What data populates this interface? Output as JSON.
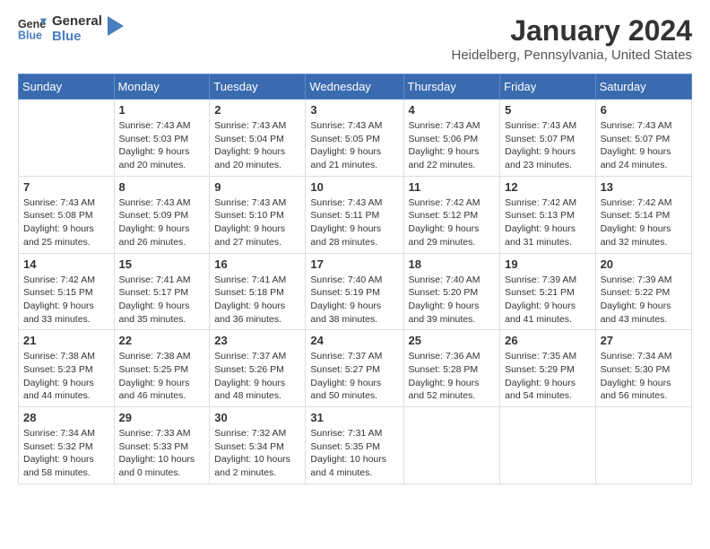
{
  "logo": {
    "line1": "General",
    "line2": "Blue"
  },
  "title": "January 2024",
  "subtitle": "Heidelberg, Pennsylvania, United States",
  "headers": [
    "Sunday",
    "Monday",
    "Tuesday",
    "Wednesday",
    "Thursday",
    "Friday",
    "Saturday"
  ],
  "weeks": [
    [
      {
        "day": "",
        "sunrise": "",
        "sunset": "",
        "daylight": ""
      },
      {
        "day": "1",
        "sunrise": "Sunrise: 7:43 AM",
        "sunset": "Sunset: 5:03 PM",
        "daylight": "Daylight: 9 hours and 20 minutes."
      },
      {
        "day": "2",
        "sunrise": "Sunrise: 7:43 AM",
        "sunset": "Sunset: 5:04 PM",
        "daylight": "Daylight: 9 hours and 20 minutes."
      },
      {
        "day": "3",
        "sunrise": "Sunrise: 7:43 AM",
        "sunset": "Sunset: 5:05 PM",
        "daylight": "Daylight: 9 hours and 21 minutes."
      },
      {
        "day": "4",
        "sunrise": "Sunrise: 7:43 AM",
        "sunset": "Sunset: 5:06 PM",
        "daylight": "Daylight: 9 hours and 22 minutes."
      },
      {
        "day": "5",
        "sunrise": "Sunrise: 7:43 AM",
        "sunset": "Sunset: 5:07 PM",
        "daylight": "Daylight: 9 hours and 23 minutes."
      },
      {
        "day": "6",
        "sunrise": "Sunrise: 7:43 AM",
        "sunset": "Sunset: 5:07 PM",
        "daylight": "Daylight: 9 hours and 24 minutes."
      }
    ],
    [
      {
        "day": "7",
        "sunrise": "Sunrise: 7:43 AM",
        "sunset": "Sunset: 5:08 PM",
        "daylight": "Daylight: 9 hours and 25 minutes."
      },
      {
        "day": "8",
        "sunrise": "Sunrise: 7:43 AM",
        "sunset": "Sunset: 5:09 PM",
        "daylight": "Daylight: 9 hours and 26 minutes."
      },
      {
        "day": "9",
        "sunrise": "Sunrise: 7:43 AM",
        "sunset": "Sunset: 5:10 PM",
        "daylight": "Daylight: 9 hours and 27 minutes."
      },
      {
        "day": "10",
        "sunrise": "Sunrise: 7:43 AM",
        "sunset": "Sunset: 5:11 PM",
        "daylight": "Daylight: 9 hours and 28 minutes."
      },
      {
        "day": "11",
        "sunrise": "Sunrise: 7:42 AM",
        "sunset": "Sunset: 5:12 PM",
        "daylight": "Daylight: 9 hours and 29 minutes."
      },
      {
        "day": "12",
        "sunrise": "Sunrise: 7:42 AM",
        "sunset": "Sunset: 5:13 PM",
        "daylight": "Daylight: 9 hours and 31 minutes."
      },
      {
        "day": "13",
        "sunrise": "Sunrise: 7:42 AM",
        "sunset": "Sunset: 5:14 PM",
        "daylight": "Daylight: 9 hours and 32 minutes."
      }
    ],
    [
      {
        "day": "14",
        "sunrise": "Sunrise: 7:42 AM",
        "sunset": "Sunset: 5:15 PM",
        "daylight": "Daylight: 9 hours and 33 minutes."
      },
      {
        "day": "15",
        "sunrise": "Sunrise: 7:41 AM",
        "sunset": "Sunset: 5:17 PM",
        "daylight": "Daylight: 9 hours and 35 minutes."
      },
      {
        "day": "16",
        "sunrise": "Sunrise: 7:41 AM",
        "sunset": "Sunset: 5:18 PM",
        "daylight": "Daylight: 9 hours and 36 minutes."
      },
      {
        "day": "17",
        "sunrise": "Sunrise: 7:40 AM",
        "sunset": "Sunset: 5:19 PM",
        "daylight": "Daylight: 9 hours and 38 minutes."
      },
      {
        "day": "18",
        "sunrise": "Sunrise: 7:40 AM",
        "sunset": "Sunset: 5:20 PM",
        "daylight": "Daylight: 9 hours and 39 minutes."
      },
      {
        "day": "19",
        "sunrise": "Sunrise: 7:39 AM",
        "sunset": "Sunset: 5:21 PM",
        "daylight": "Daylight: 9 hours and 41 minutes."
      },
      {
        "day": "20",
        "sunrise": "Sunrise: 7:39 AM",
        "sunset": "Sunset: 5:22 PM",
        "daylight": "Daylight: 9 hours and 43 minutes."
      }
    ],
    [
      {
        "day": "21",
        "sunrise": "Sunrise: 7:38 AM",
        "sunset": "Sunset: 5:23 PM",
        "daylight": "Daylight: 9 hours and 44 minutes."
      },
      {
        "day": "22",
        "sunrise": "Sunrise: 7:38 AM",
        "sunset": "Sunset: 5:25 PM",
        "daylight": "Daylight: 9 hours and 46 minutes."
      },
      {
        "day": "23",
        "sunrise": "Sunrise: 7:37 AM",
        "sunset": "Sunset: 5:26 PM",
        "daylight": "Daylight: 9 hours and 48 minutes."
      },
      {
        "day": "24",
        "sunrise": "Sunrise: 7:37 AM",
        "sunset": "Sunset: 5:27 PM",
        "daylight": "Daylight: 9 hours and 50 minutes."
      },
      {
        "day": "25",
        "sunrise": "Sunrise: 7:36 AM",
        "sunset": "Sunset: 5:28 PM",
        "daylight": "Daylight: 9 hours and 52 minutes."
      },
      {
        "day": "26",
        "sunrise": "Sunrise: 7:35 AM",
        "sunset": "Sunset: 5:29 PM",
        "daylight": "Daylight: 9 hours and 54 minutes."
      },
      {
        "day": "27",
        "sunrise": "Sunrise: 7:34 AM",
        "sunset": "Sunset: 5:30 PM",
        "daylight": "Daylight: 9 hours and 56 minutes."
      }
    ],
    [
      {
        "day": "28",
        "sunrise": "Sunrise: 7:34 AM",
        "sunset": "Sunset: 5:32 PM",
        "daylight": "Daylight: 9 hours and 58 minutes."
      },
      {
        "day": "29",
        "sunrise": "Sunrise: 7:33 AM",
        "sunset": "Sunset: 5:33 PM",
        "daylight": "Daylight: 10 hours and 0 minutes."
      },
      {
        "day": "30",
        "sunrise": "Sunrise: 7:32 AM",
        "sunset": "Sunset: 5:34 PM",
        "daylight": "Daylight: 10 hours and 2 minutes."
      },
      {
        "day": "31",
        "sunrise": "Sunrise: 7:31 AM",
        "sunset": "Sunset: 5:35 PM",
        "daylight": "Daylight: 10 hours and 4 minutes."
      },
      {
        "day": "",
        "sunrise": "",
        "sunset": "",
        "daylight": ""
      },
      {
        "day": "",
        "sunrise": "",
        "sunset": "",
        "daylight": ""
      },
      {
        "day": "",
        "sunrise": "",
        "sunset": "",
        "daylight": ""
      }
    ]
  ]
}
